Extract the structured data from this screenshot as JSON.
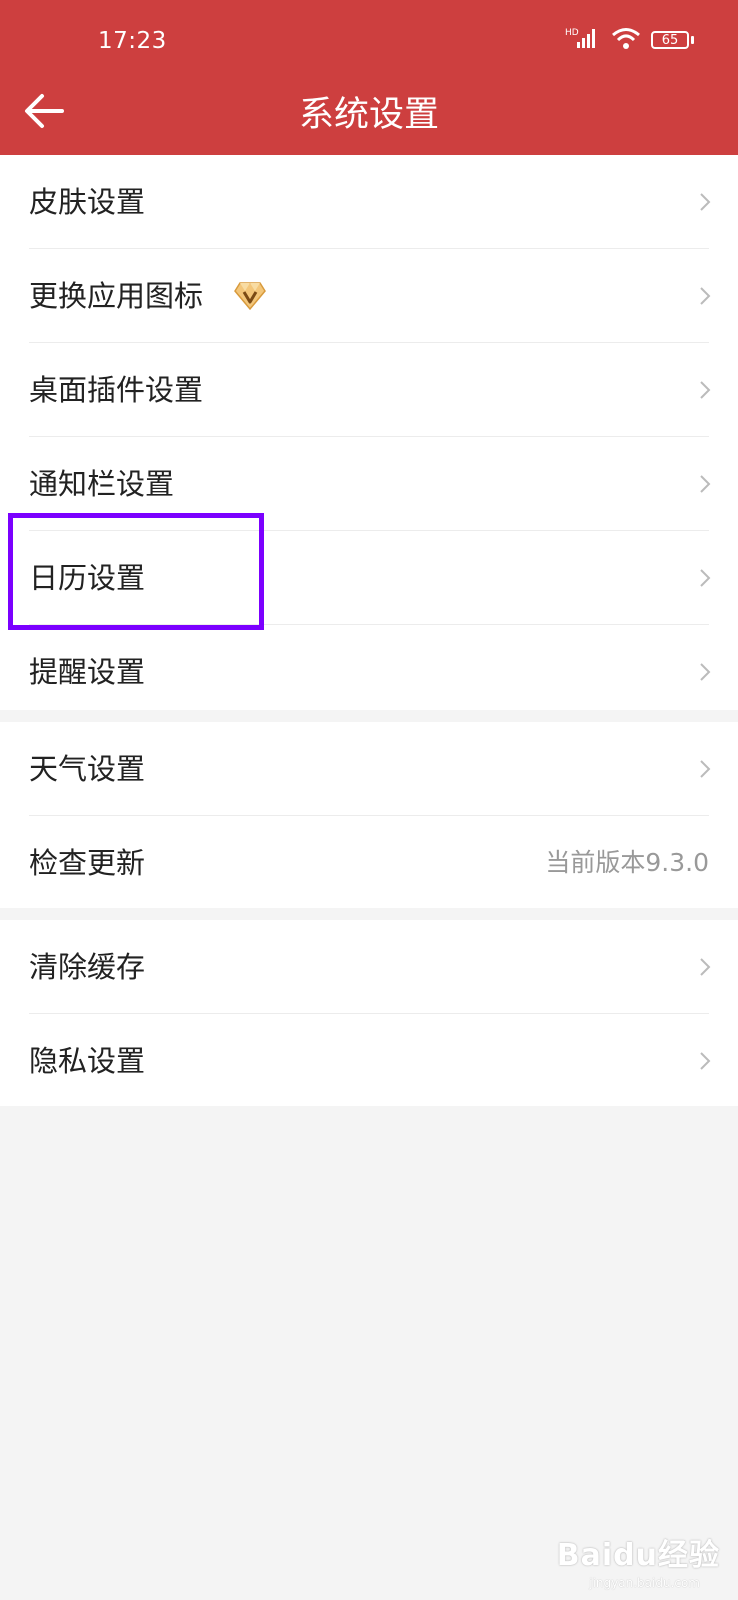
{
  "status_bar": {
    "time": "17:23",
    "signal_label": "HD",
    "battery": "65"
  },
  "header": {
    "title": "系统设置",
    "back_icon": "arrow-left-icon",
    "background_color": "#cd3f3f"
  },
  "groups": [
    {
      "items": [
        {
          "label": "皮肤设置"
        },
        {
          "label": "更换应用图标",
          "badge_icon": "vip-diamond-icon"
        },
        {
          "label": "桌面插件设置"
        },
        {
          "label": "通知栏设置"
        },
        {
          "label": "日历设置",
          "highlighted": true
        },
        {
          "label": "提醒设置"
        }
      ]
    },
    {
      "items": [
        {
          "label": "天气设置"
        },
        {
          "label": "检查更新",
          "value": "当前版本9.3.0"
        }
      ]
    },
    {
      "items": [
        {
          "label": "清除缓存"
        },
        {
          "label": "隐私设置"
        }
      ]
    }
  ],
  "highlight_color": "#7b00ff",
  "watermark": {
    "text": "Baidu经验",
    "sub": "jingyan.baidu.com"
  }
}
